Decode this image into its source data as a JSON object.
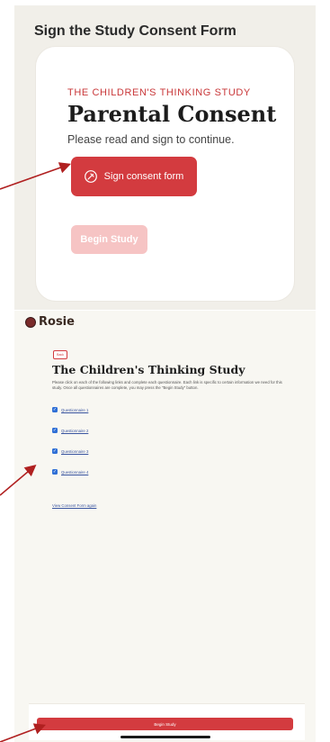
{
  "top": {
    "title": "Sign the Study Consent Form",
    "card": {
      "study_name": "THE CHILDREN'S THINKING STUDY",
      "heading": "Parental Consent",
      "subtext": "Please read and sign to continue.",
      "sign_button_label": "Sign consent form",
      "sign_icon": "pen-nib-icon",
      "begin_button_label": "Begin Study"
    }
  },
  "bottom": {
    "logo_text": "Rosie",
    "back_label": "Back",
    "study_title": "The Children's Thinking Study",
    "description": "Please click on each of the following links and complete each questionnaire. Each link is specific to certain information we need for this study. Once all questionnaires are complete, you may press the \"Begin Study\" button.",
    "questionnaires": [
      {
        "label": "Questionnaire 1",
        "checked": true
      },
      {
        "label": "Questionnaire 2",
        "checked": true
      },
      {
        "label": "Questionnaire 3",
        "checked": true
      },
      {
        "label": "Questionnaire 4",
        "checked": true
      }
    ],
    "view_consent_label": "View Consent Form again",
    "begin_study_label": "Begin Study"
  },
  "colors": {
    "accent": "#d33b3f",
    "disabled_accent": "#f6c4c4",
    "panel_bg": "#f1efe9",
    "annotation_arrow": "#b02020"
  }
}
